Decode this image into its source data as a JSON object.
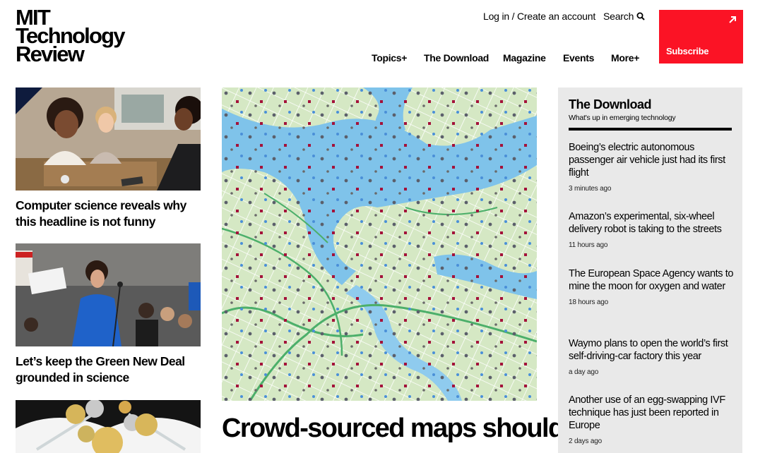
{
  "header": {
    "logo_lines": [
      "MIT",
      "Technology",
      "Review"
    ],
    "login_label": "Log in / Create an account",
    "search_label": "Search",
    "nav": [
      "Topics+",
      "The Download",
      "Magazine",
      "Events",
      "More+"
    ],
    "subscribe_label": "Subscribe",
    "brand_color": "#fb1325"
  },
  "left_column": [
    {
      "headline": "Computer science reveals why this headline is not funny"
    },
    {
      "headline": "Let’s keep the Green New Deal grounded in science"
    }
  ],
  "feature": {
    "headline": "Crowd-sourced maps should"
  },
  "download_panel": {
    "title": "The Download",
    "subtitle": "What's up in emerging technology",
    "stories": [
      {
        "title": "Boeing’s electric autonomous passenger air vehicle just had its first flight",
        "time": "3 minutes ago"
      },
      {
        "title": "Amazon’s experimental, six-wheel delivery robot is taking to the streets",
        "time": "11 hours ago"
      },
      {
        "title": "The European Space Agency wants to mine the moon for oxygen and water",
        "time": "18 hours ago"
      },
      {
        "title": "Waymo plans to open the world’s first self-driving-car factory this year",
        "time": "a day ago"
      },
      {
        "title": "Another use of an egg-swapping IVF technique has just been reported in Europe",
        "time": "2 days ago"
      }
    ]
  }
}
